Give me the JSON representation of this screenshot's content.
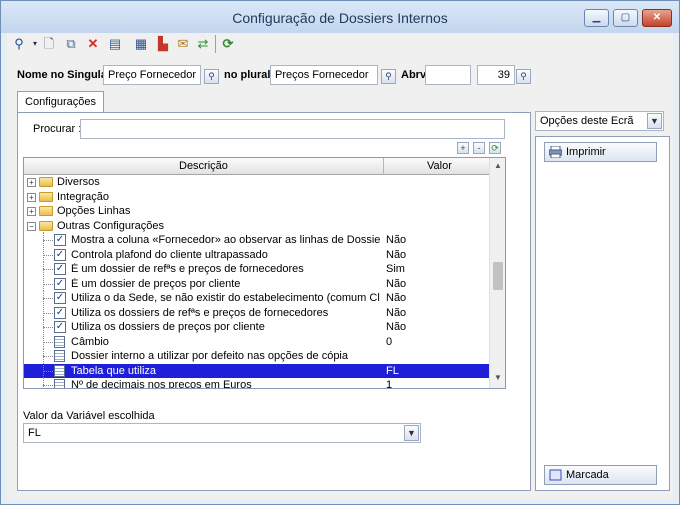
{
  "window": {
    "title": "Configuração de Dossiers Internos",
    "minimize": "▁",
    "maximize": "▢",
    "close": "✕"
  },
  "toolbar": {
    "icons": [
      "search-icon",
      "new-document-icon",
      "copy-icon",
      "delete-icon",
      "properties-icon",
      "table-icon",
      "chart-icon",
      "export-icon",
      "refresh-icon",
      "sync-icon"
    ]
  },
  "header": {
    "singular_label": "Nome no Singular",
    "singular_value": "Preço Fornecedor",
    "plural_label": "no plural",
    "plural_value": "Preços Fornecedor",
    "abrv_label": "Abrv.",
    "abrv_value": "",
    "number_value": "39"
  },
  "tabs": [
    {
      "label": "Configurações"
    }
  ],
  "search": {
    "label": "Procurar :",
    "value": ""
  },
  "grid_buttons": {
    "add": "+",
    "remove": "-"
  },
  "grid": {
    "columns": [
      "Descrição",
      "Valor"
    ],
    "rows": [
      {
        "type": "group",
        "expanded": false,
        "label": "Diversos",
        "value": ""
      },
      {
        "type": "group",
        "expanded": false,
        "label": "Integração",
        "value": ""
      },
      {
        "type": "group",
        "expanded": false,
        "label": "Opções Linhas",
        "value": ""
      },
      {
        "type": "group",
        "expanded": true,
        "label": "Outras Configurações",
        "value": ""
      },
      {
        "type": "check",
        "label": "Mostra a coluna «Fornecedor» ao observar as linhas de Dossiers ...",
        "value": "Não"
      },
      {
        "type": "check",
        "label": "Controla plafond do cliente ultrapassado",
        "value": "Não"
      },
      {
        "type": "check",
        "label": "É um dossier de refªs e preços de fornecedores",
        "value": "Sim"
      },
      {
        "type": "check",
        "label": "É um dossier de preços por cliente",
        "value": "Não"
      },
      {
        "type": "check",
        "label": "Utiliza o da Sede, se não existir do estabelecimento (comum Clien...",
        "value": "Não"
      },
      {
        "type": "check",
        "label": "Utiliza os dossiers de refªs e preços de fornecedores",
        "value": "Não"
      },
      {
        "type": "check",
        "label": "Utiliza os dossiers de preços por cliente",
        "value": "Não"
      },
      {
        "type": "doc",
        "label": "Câmbio",
        "value": "0"
      },
      {
        "type": "doc",
        "label": "Dossier interno a utilizar por defeito nas opções de cópia",
        "value": ""
      },
      {
        "type": "doc",
        "label": "Tabela que utiliza",
        "value": "FL",
        "selected": true
      },
      {
        "type": "doc",
        "label": "Nº de decimais nos preços em Euros",
        "value": "1"
      }
    ]
  },
  "variable": {
    "label": "Valor da Variável escolhida",
    "value": "FL"
  },
  "side_panel": {
    "title": "Opções deste Ecrã",
    "print_label": "Imprimir",
    "marked_label": "Marcada"
  }
}
